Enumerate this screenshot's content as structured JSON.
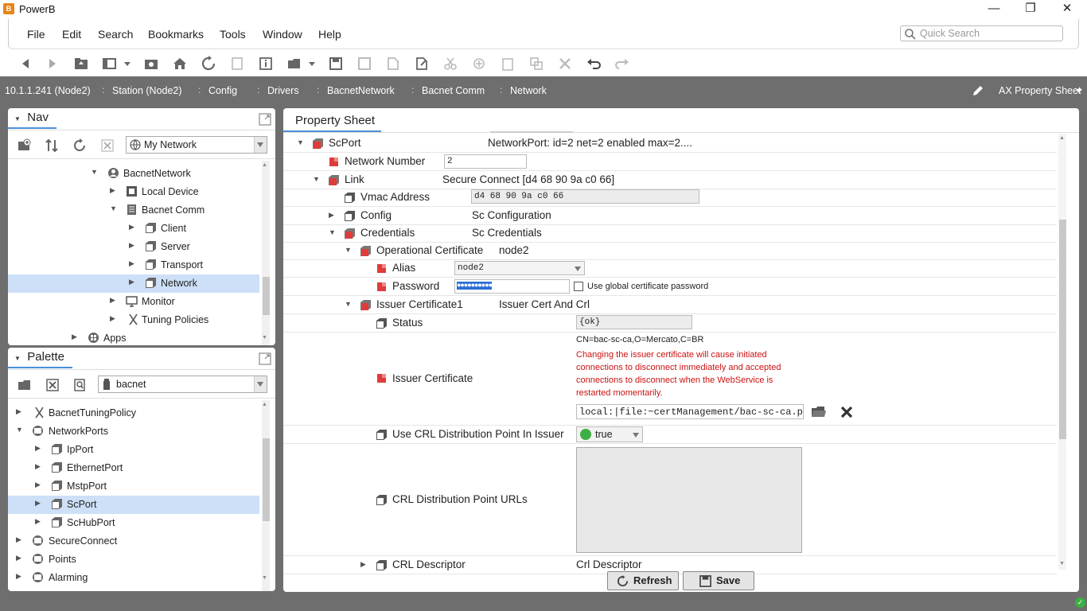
{
  "window": {
    "title": "PowerB",
    "app_icon_glyph": "B",
    "minimize": "—",
    "maximize": "❐",
    "close": "✕"
  },
  "menu": {
    "items": [
      "File",
      "Edit",
      "Search",
      "Bookmarks",
      "Tools",
      "Window",
      "Help"
    ],
    "quick_search_placeholder": "Quick Search"
  },
  "breadcrumb": {
    "items": [
      "10.1.1.241 (Node2)",
      "Station (Node2)",
      "Config",
      "Drivers",
      "BacnetNetwork",
      "Bacnet Comm",
      "Network"
    ],
    "view": "AX Property Sheet"
  },
  "nav": {
    "title": "Nav",
    "network_select": "My Network",
    "tree": [
      {
        "label": "BacnetNetwork",
        "icon": "network-icon"
      },
      {
        "label": "Local Device",
        "icon": "device-icon"
      },
      {
        "label": "Bacnet Comm",
        "icon": "comm-icon"
      },
      {
        "label": "Client",
        "icon": "component-icon"
      },
      {
        "label": "Server",
        "icon": "component-icon"
      },
      {
        "label": "Transport",
        "icon": "component-icon"
      },
      {
        "label": "Network",
        "icon": "component-icon"
      },
      {
        "label": "Monitor",
        "icon": "monitor-icon"
      },
      {
        "label": "Tuning Policies",
        "icon": "tuning-icon"
      },
      {
        "label": "Apps",
        "icon": "apps-icon"
      }
    ]
  },
  "palette": {
    "title": "Palette",
    "module_select": "bacnet",
    "tree": [
      {
        "label": "BacnetTuningPolicy"
      },
      {
        "label": "NetworkPorts"
      },
      {
        "label": "IpPort"
      },
      {
        "label": "EthernetPort"
      },
      {
        "label": "MstpPort"
      },
      {
        "label": "ScPort"
      },
      {
        "label": "ScHubPort"
      },
      {
        "label": "SecureConnect"
      },
      {
        "label": "Points"
      },
      {
        "label": "Alarming"
      }
    ]
  },
  "property_sheet": {
    "tab": "Property Sheet",
    "rows": {
      "scport": {
        "name": "ScPort",
        "value": "NetworkPort: id=2 net=2 enabled max=2...."
      },
      "network_number": {
        "name": "Network Number",
        "value": "2"
      },
      "link": {
        "name": "Link",
        "value": "Secure Connect [d4 68 90 9a c0 66]"
      },
      "vmac": {
        "name": "Vmac Address",
        "value": "d4 68 90 9a c0 66"
      },
      "config": {
        "name": "Config",
        "value": "Sc Configuration"
      },
      "credentials": {
        "name": "Credentials",
        "value": "Sc Credentials"
      },
      "op_cert": {
        "name": "Operational Certificate",
        "value": "node2"
      },
      "alias": {
        "name": "Alias",
        "value": "node2"
      },
      "password": {
        "name": "Password",
        "value": "●●●●●●●●●●",
        "global_label": "Use global certificate password"
      },
      "issuer_cert1": {
        "name": "Issuer Certificate1",
        "value": "Issuer Cert And Crl"
      },
      "status": {
        "name": "Status",
        "value": "{ok}"
      },
      "issuer_cert": {
        "name": "Issuer Certificate",
        "subject": "CN=bac-sc-ca,O=Mercato,C=BR",
        "warning": "Changing the issuer certificate will cause initiated connections to disconnect immediately and accepted connections to disconnect when the WebService is restarted momentarily.",
        "file": "local:|file:~certManagement/bac-sc-ca.pem"
      },
      "use_crl": {
        "name": "Use CRL Distribution Point In Issuer",
        "value": "true"
      },
      "crl_urls": {
        "name": "CRL Distribution Point URLs"
      },
      "crl_desc": {
        "name": "CRL Descriptor",
        "value": "Crl Descriptor"
      }
    },
    "buttons": {
      "refresh": "Refresh",
      "save": "Save"
    }
  },
  "colors": {
    "accent": "#4a90d9",
    "selection": "#cde0f7",
    "chrome": "#6e6e6e",
    "status_ok": "#3cb043",
    "warning": "#cc1111",
    "icon_red": "#e03b3b"
  }
}
